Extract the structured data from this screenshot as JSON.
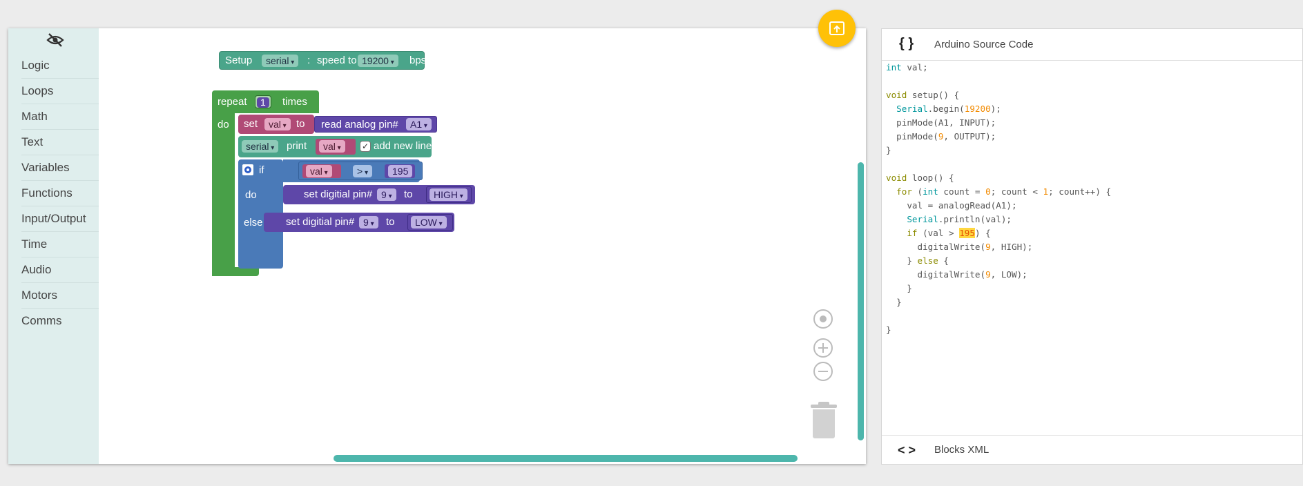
{
  "toolbox": {
    "hide_icon": "eye-off-icon",
    "categories": [
      "Logic",
      "Loops",
      "Math",
      "Text",
      "Variables",
      "Functions",
      "Input/Output",
      "Time",
      "Audio",
      "Motors",
      "Comms"
    ]
  },
  "workspace": {
    "setup_block": {
      "label": "Setup",
      "port": "serial",
      "sep": ":",
      "speed_label": "speed to",
      "speed": "19200",
      "unit": "bps"
    },
    "repeat_block": {
      "label": "repeat",
      "times_value": "1",
      "times_label": "times",
      "do_label": "do"
    },
    "set_block": {
      "label": "set",
      "variable": "val",
      "to_label": "to"
    },
    "analog_block": {
      "label": "read analog pin#",
      "pin": "A1"
    },
    "print_block": {
      "port": "serial",
      "label": "print",
      "variable": "val",
      "checkbox_mark": "✓",
      "newline_label": "add new line"
    },
    "if_block": {
      "if_label": "if",
      "do_label": "do",
      "else_label": "else"
    },
    "compare_block": {
      "variable": "val",
      "operator": ">",
      "value": "195"
    },
    "digital_high": {
      "label": "set digitial pin#",
      "pin": "9",
      "to_label": "to",
      "state": "HIGH"
    },
    "digital_low": {
      "label": "set digitial pin#",
      "pin": "9",
      "to_label": "to",
      "state": "LOW"
    }
  },
  "fab": {
    "icon": "upload-to-board-icon"
  },
  "controls": {
    "center": "target-icon",
    "zoom_in": "zoom-in-icon",
    "zoom_out": "zoom-out-icon",
    "trash": "trash-icon"
  },
  "source_panel": {
    "icon": "{ }",
    "title": "Arduino Source Code",
    "footer_icon": "< >",
    "footer_title": "Blocks XML"
  },
  "code": {
    "l1_type": "int",
    "l1_rest": " val;",
    "l3_type": "void",
    "l3_rest": " setup() {",
    "l4_obj": "Serial",
    "l4_a": ".begin(",
    "l4_num": "19200",
    "l4_b": ");",
    "l5": "  pinMode(A1, INPUT);",
    "l6_a": "  pinMode(",
    "l6_num": "9",
    "l6_b": ", OUTPUT);",
    "l7": "}",
    "l9_type": "void",
    "l9_rest": " loop() {",
    "l10_kw": "for",
    "l10_a": " (",
    "l10_type": "int",
    "l10_b": " count = ",
    "l10_n0": "0",
    "l10_c": "; count < ",
    "l10_n1": "1",
    "l10_d": "; count++) {",
    "l11": "    val = analogRead(A1);",
    "l12_obj": "Serial",
    "l12_rest": ".println(val);",
    "l13_kw": "if",
    "l13_a": " (val > ",
    "l13_num": "195",
    "l13_b": ") {",
    "l14_a": "      digitalWrite(",
    "l14_num": "9",
    "l14_b": ", HIGH);",
    "l15_a": "    } ",
    "l15_kw": "else",
    "l15_b": " {",
    "l16_a": "      digitalWrite(",
    "l16_num": "9",
    "l16_b": ", LOW);",
    "l17": "    }",
    "l18": "  }",
    "l20": "}"
  },
  "colors": {
    "accent": "#4db6ac",
    "fab": "#ffc107",
    "toolbox": "#dfeeed",
    "setup": "#4aa58a",
    "loop": "#48a048",
    "variable": "#b04a76",
    "io": "#5e47a8",
    "logic": "#4a7ab8"
  }
}
